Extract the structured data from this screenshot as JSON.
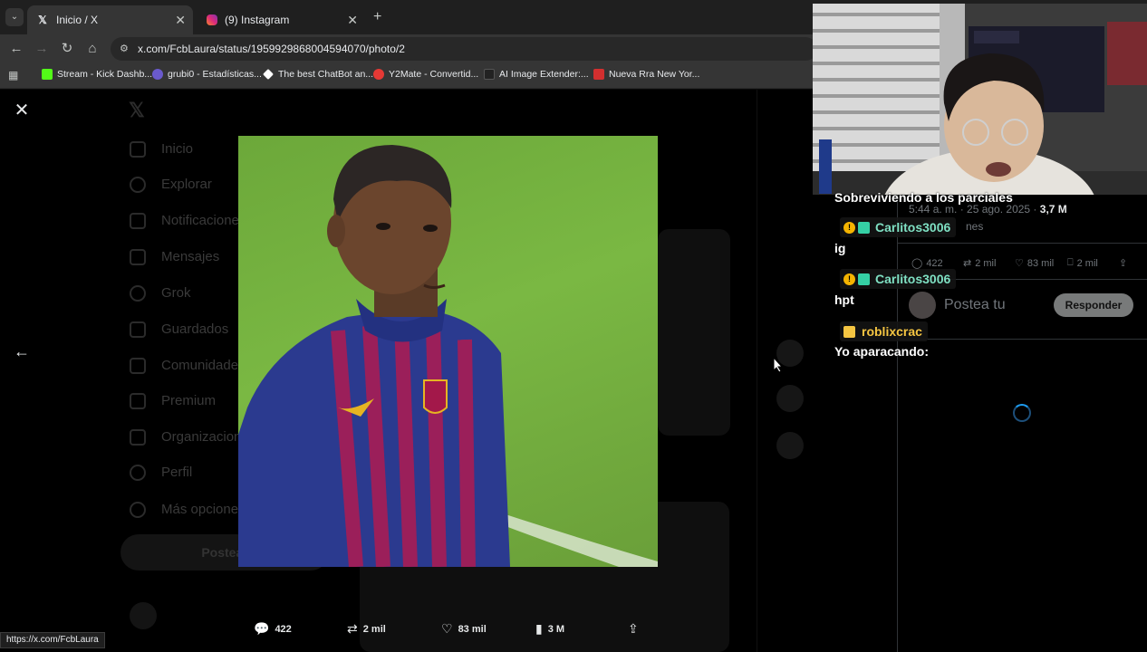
{
  "browser": {
    "tabs": [
      {
        "title": "Inicio / X",
        "icon": "x-logo-icon",
        "active": true
      },
      {
        "title": "(9) Instagram",
        "icon": "instagram-icon",
        "active": false
      }
    ],
    "new_tab": "+",
    "url": "x.com/FcbLaura/status/1959929868004594070/photo/2",
    "bookmarks": [
      {
        "label": "Stream - Kick Dashb...",
        "color": "#53fc18"
      },
      {
        "label": "grubi0 - Estadísticas...",
        "color": "#6a5acd"
      },
      {
        "label": "The best ChatBot an...",
        "color": "#ffffff"
      },
      {
        "label": "Y2Mate - Convertid...",
        "color": "#e53935"
      },
      {
        "label": "AI Image Extender:...",
        "color": "#222222"
      },
      {
        "label": "Nueva Rra New Yor...",
        "color": "#d32f2f"
      }
    ]
  },
  "sidebar": {
    "items": [
      "Inicio",
      "Explorar",
      "Notificaciones",
      "Mensajes",
      "Grok",
      "Guardados",
      "Comunidades",
      "Premium",
      "Organizaciones",
      "Perfil",
      "Más opciones"
    ],
    "post_button": "Postear"
  },
  "tweet": {
    "text_partial": "Sobreviviendo a los parciales",
    "time": "5:44 a. m. · 25 ago. 2025 ·",
    "views": "3,7 M",
    "views_label": "nes",
    "metrics": {
      "replies": "422",
      "reposts": "2 mil",
      "likes": "83 mil",
      "bookmarks": "2 mil"
    },
    "reply_placeholder": "Postea tu",
    "reply_button": "Responder"
  },
  "photo_actions": {
    "replies": "422",
    "reposts": "2 mil",
    "likes": "83 mil",
    "views": "3 M"
  },
  "status_url": "https://x.com/FcbLaura",
  "chat": [
    {
      "user": "Carlitos3006",
      "message": "ig",
      "color": "#7fe0c3"
    },
    {
      "user": "Carlitos3006",
      "message": "hpt",
      "color": "#7fe0c3"
    },
    {
      "user": "roblixcrac",
      "message": "Yo aparacando:",
      "color": "#f5c542"
    }
  ]
}
